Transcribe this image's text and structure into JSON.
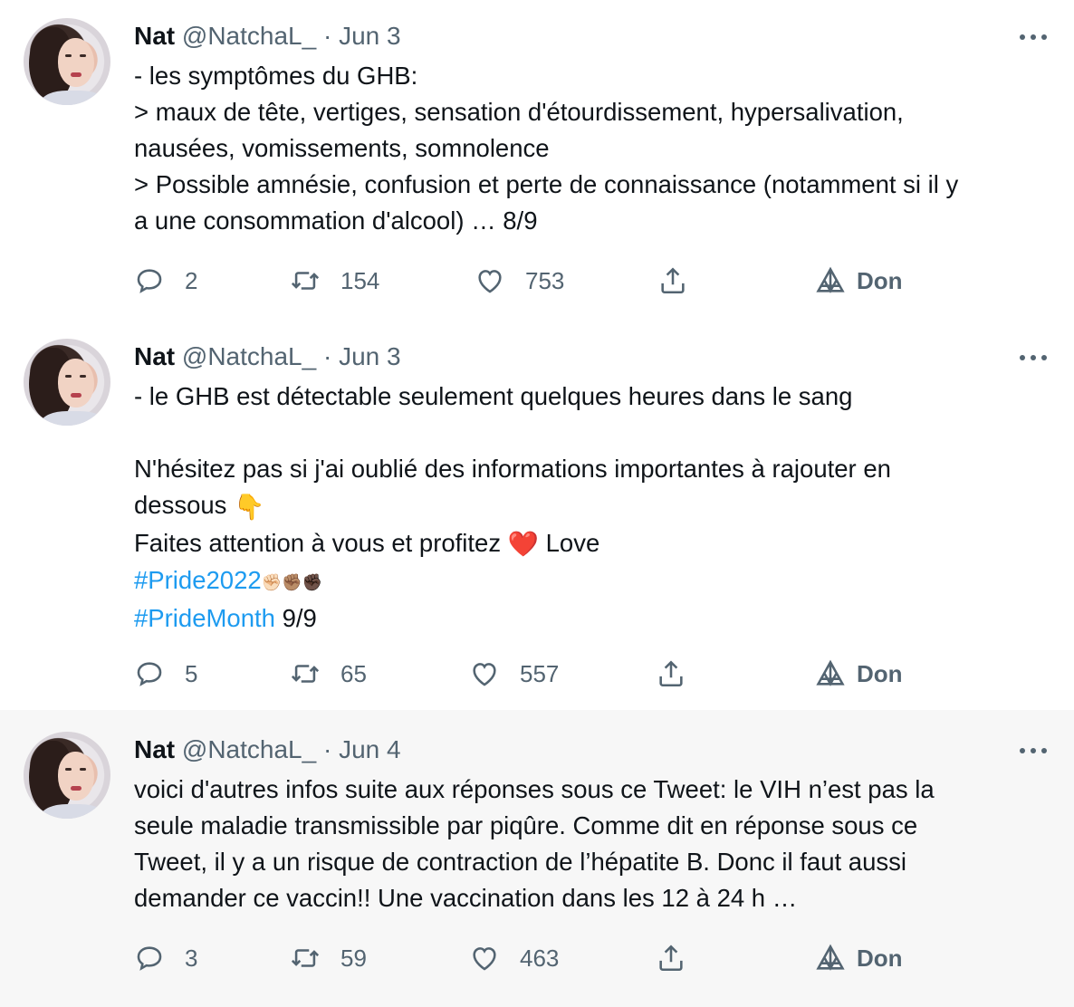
{
  "tweets": [
    {
      "author_name": "Nat",
      "handle": "@NatchaL_",
      "separator": "·",
      "date": "Jun 3",
      "lines": [
        "- les symptômes du GHB:",
        "> maux de tête, vertiges, sensation d'étourdissement, hypersalivation,",
        "nausées, vomissements, somnolence",
        "> Possible amnésie, confusion et perte de connaissance (notamment si il y",
        "a une consommation d'alcool)  … 8/9"
      ],
      "replies": "2",
      "retweets": "154",
      "likes": "753",
      "don_label": "Don"
    },
    {
      "author_name": "Nat",
      "handle": "@NatchaL_",
      "separator": "·",
      "date": "Jun 3",
      "line1": "- le GHB est détectable seulement quelques heures dans le sang",
      "line2": "N'hésitez pas si j'ai oublié des informations importantes à rajouter en",
      "line3": "dessous",
      "emoji_point": "👇",
      "line4": "Faites attention à vous et profitez",
      "emoji_heart": "❤️",
      "line4_end": "Love",
      "hashtag1": "#Pride2022",
      "emoji_hands": "✊🏻✊🏽✊🏿",
      "hashtag2": "#PrideMonth",
      "thread_count": "9/9",
      "replies": "5",
      "retweets": "65",
      "likes": "557",
      "don_label": "Don"
    },
    {
      "author_name": "Nat",
      "handle": "@NatchaL_",
      "separator": "·",
      "date": "Jun 4",
      "lines": [
        "voici d'autres infos suite aux réponses sous ce Tweet: le VIH n’est pas la",
        "seule maladie transmissible par piqûre. Comme dit en réponse sous ce",
        "Tweet, il y a un risque de contraction de l’hépatite B. Donc il faut aussi",
        "demander ce vaccin!! Une vaccination dans les 12 à 24 h …"
      ],
      "replies": "3",
      "retweets": "59",
      "likes": "463",
      "don_label": "Don"
    }
  ],
  "colors": {
    "text": "#0f1419",
    "secondary": "#536471",
    "link": "#1d9bf0",
    "thread_line": "#cfd9de",
    "highlight_bg": "#f7f7f7"
  },
  "icons": [
    "reply-icon",
    "retweet-icon",
    "like-icon",
    "share-icon",
    "brave-triangle-icon",
    "more-icon"
  ]
}
